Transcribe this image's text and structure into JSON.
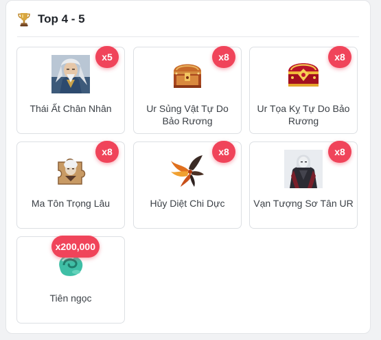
{
  "header": {
    "title": "Top 4 - 5",
    "icon": "trophy-icon",
    "accent": "#c99a3a"
  },
  "badge_color": "#f0445a",
  "items": [
    {
      "name": "Thái Ất Chân Nhân",
      "qty": "x5",
      "icon": "warrior-portrait-icon"
    },
    {
      "name": "Ur Sủng Vật Tự Do Bảo Rương",
      "qty": "x8",
      "icon": "treasure-chest-icon"
    },
    {
      "name": "Ur Tọa Kỵ Tự Do Bảo Rương",
      "qty": "x8",
      "icon": "red-gold-chest-icon"
    },
    {
      "name": "Ma Tôn Trọng Lâu",
      "qty": "x8",
      "icon": "puzzle-piece-icon"
    },
    {
      "name": "Hủy Diệt Chi Dực",
      "qty": "x8",
      "icon": "fire-wing-icon"
    },
    {
      "name": "Vạn Tượng Sơ Tân UR",
      "qty": "x8",
      "icon": "hooded-figure-icon"
    },
    {
      "name": "Tiên ngọc",
      "qty": "x200,000",
      "icon": "jade-gem-icon"
    }
  ]
}
